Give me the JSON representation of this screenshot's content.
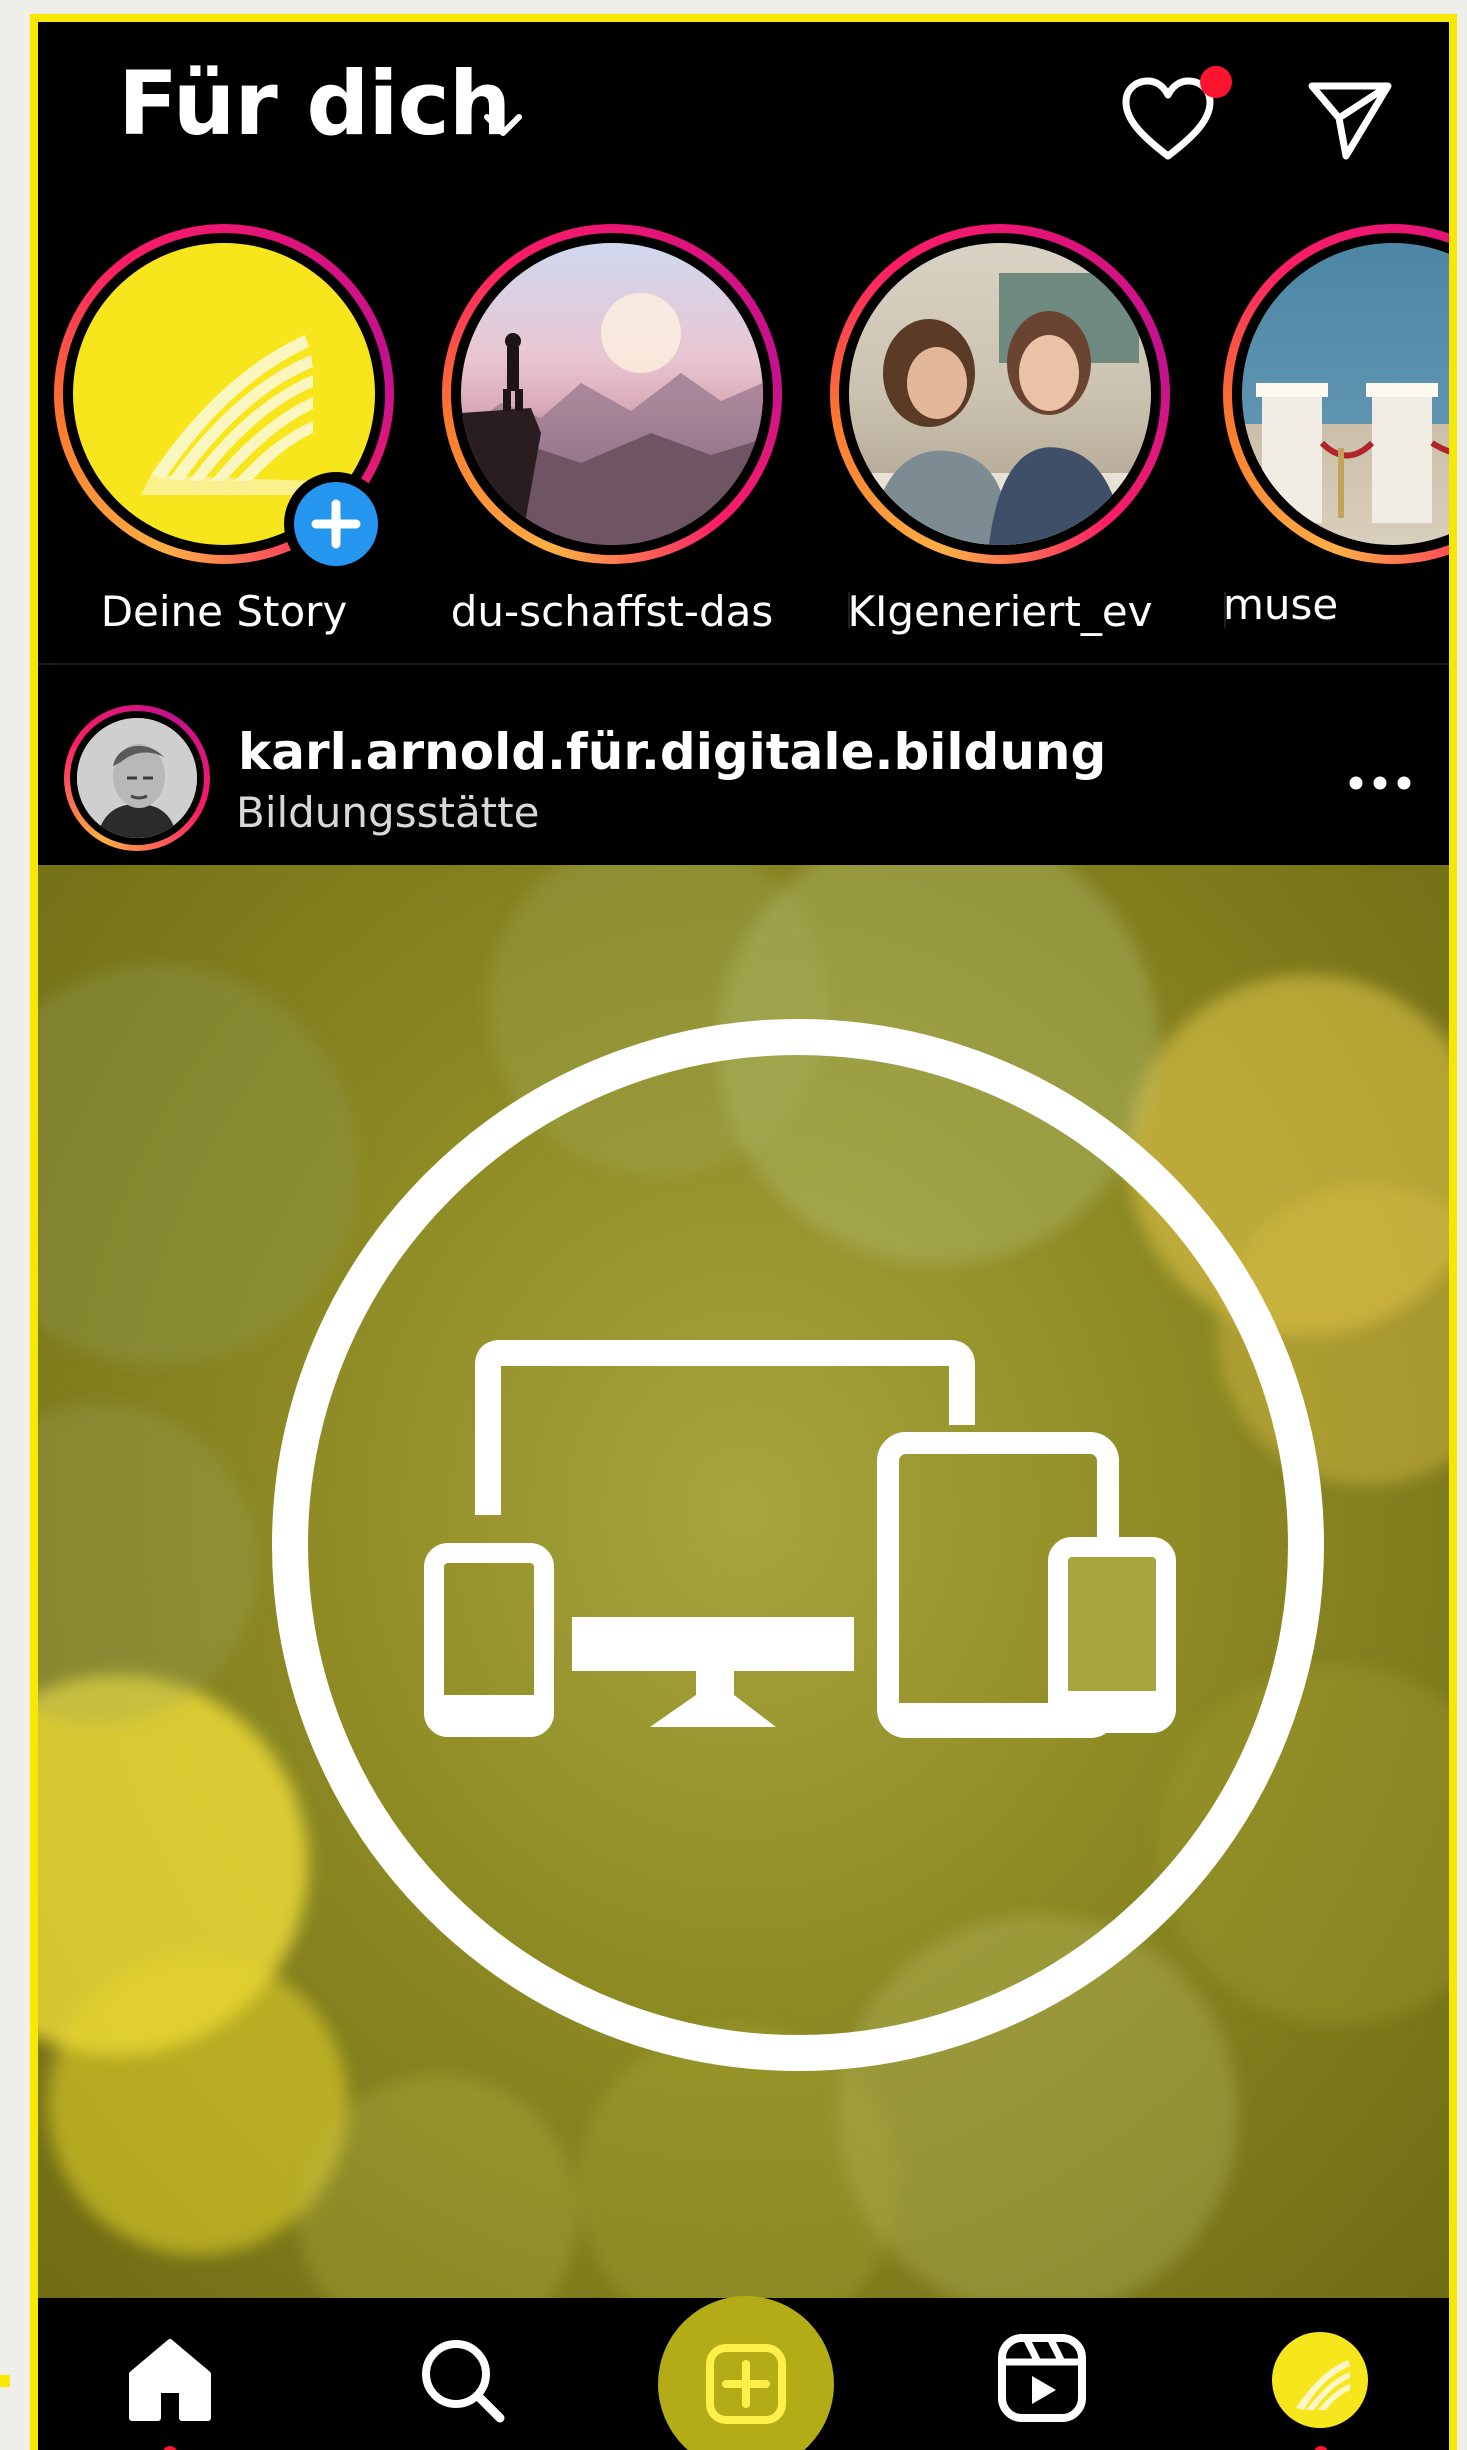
{
  "header": {
    "title": "Für dich",
    "icons": [
      "chevron-down-icon",
      "heart-icon",
      "send-icon"
    ],
    "has_notification": true
  },
  "stories": [
    {
      "label": "Deine Story",
      "icon": "add-story-icon"
    },
    {
      "label": "du-schaffst-das"
    },
    {
      "label": "KIgeneriert_ev"
    },
    {
      "label": "muse"
    }
  ],
  "post": {
    "username": "karl.arnold.für.digitale.bildung",
    "subtitle": "Bildungsstätte",
    "image_icon": "devices-icon"
  },
  "nav": {
    "items": [
      "home-icon",
      "search-icon",
      "create-icon",
      "reels-icon",
      "profile-icon"
    ],
    "active": "home-icon"
  },
  "colors": {
    "accent_yellow": "#f7e800",
    "notification_red": "#ff1430",
    "badge_blue": "#2596f0",
    "create_button": "#b3ac17"
  }
}
